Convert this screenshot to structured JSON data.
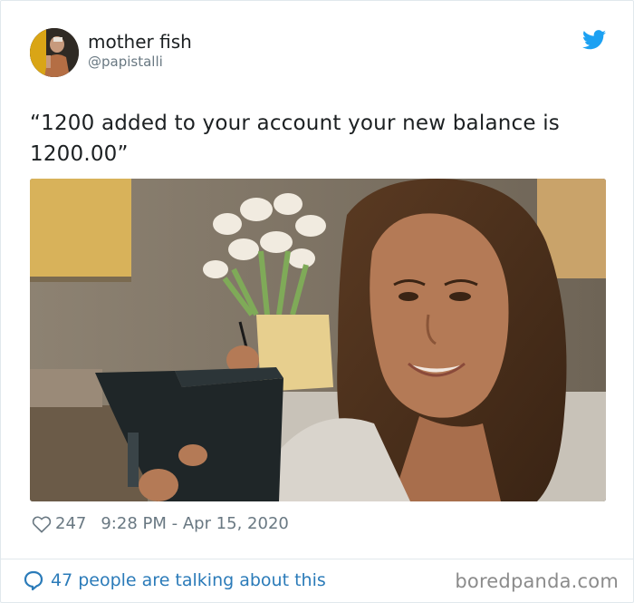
{
  "tweet": {
    "author_name": "mother fish",
    "author_handle": "@papistalli",
    "text": "“1200 added to your account your new balance is 1200.00”",
    "likes": "247",
    "timestamp": "9:28 PM - Apr 15, 2020",
    "conversation": "47 people are talking about this"
  },
  "icons": {
    "brand": "twitter-bird-icon",
    "like": "heart-icon",
    "reply": "speech-bubble-icon"
  },
  "watermark": "boredpanda.com",
  "colors": {
    "twitter_blue": "#1da1f2",
    "link_blue": "#2b7bb9",
    "meta_gray": "#697882"
  }
}
